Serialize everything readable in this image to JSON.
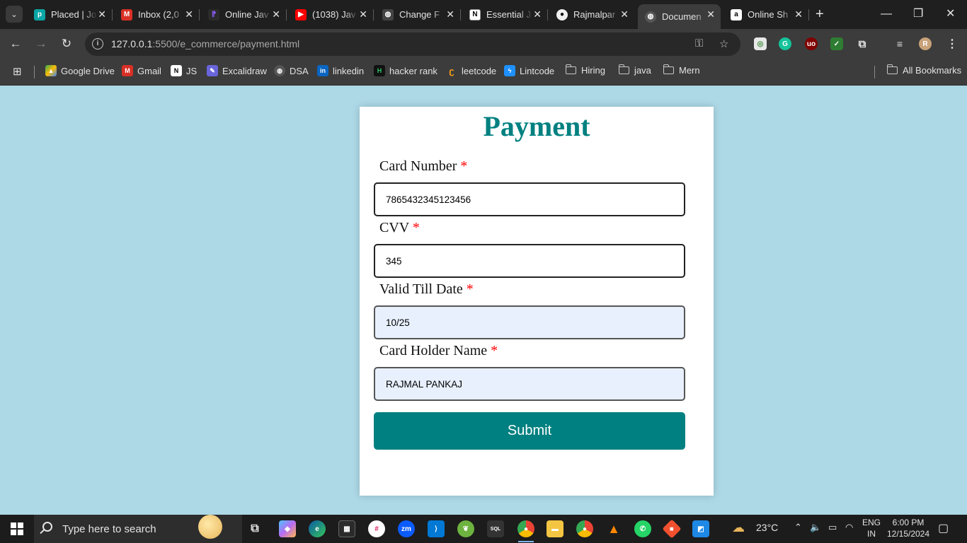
{
  "browser": {
    "tabs": [
      {
        "title": "Placed | Jo",
        "icon": "placed-icon"
      },
      {
        "title": "Inbox (2,0",
        "icon": "gmail-icon"
      },
      {
        "title": "Online Jav",
        "icon": "online-java-icon"
      },
      {
        "title": "(1038) Jav",
        "icon": "youtube-icon"
      },
      {
        "title": "Change F",
        "icon": "globe-icon"
      },
      {
        "title": "Essential J",
        "icon": "notion-icon"
      },
      {
        "title": "Rajmalpar",
        "icon": "github-icon"
      },
      {
        "title": "Documen",
        "icon": "globe-icon",
        "active": true
      },
      {
        "title": "Online Sh",
        "icon": "amazon-icon"
      }
    ],
    "url_host": "127.0.0.1",
    "url_path": ":5500/e_commerce/payment.html",
    "bookmarks": [
      {
        "label": "Google Drive",
        "icon": "google-drive-icon"
      },
      {
        "label": "Gmail",
        "icon": "gmail-icon"
      },
      {
        "label": "JS",
        "icon": "notion-icon"
      },
      {
        "label": "Excalidraw",
        "icon": "excalidraw-icon"
      },
      {
        "label": "DSA",
        "icon": "globe-icon"
      },
      {
        "label": "linkedin",
        "icon": "linkedin-icon"
      },
      {
        "label": "hacker rank",
        "icon": "hackerrank-icon"
      },
      {
        "label": "leetcode",
        "icon": "leetcode-icon"
      },
      {
        "label": "Lintcode",
        "icon": "lintcode-icon"
      },
      {
        "label": "Hiring",
        "icon": "folder-icon"
      },
      {
        "label": "java",
        "icon": "folder-icon"
      },
      {
        "label": "Mern",
        "icon": "folder-icon"
      }
    ],
    "all_bookmarks": "All Bookmarks"
  },
  "page": {
    "title": "Payment",
    "required_mark": "*",
    "fields": {
      "card_number": {
        "label": "Card Number",
        "value": "7865432345123456"
      },
      "cvv": {
        "label": "CVV",
        "value": "345"
      },
      "valid_till": {
        "label": "Valid Till Date",
        "value": "10/25"
      },
      "holder": {
        "label": "Card Holder Name",
        "value": "RAJMAL PANKAJ"
      }
    },
    "submit_label": "Submit"
  },
  "taskbar": {
    "search_placeholder": "Type here to search",
    "weather": "23°C",
    "lang_top": "ENG",
    "lang_bottom": "IN",
    "time": "6:00 PM",
    "date": "12/15/2024"
  },
  "colors": {
    "page_background": "#add8e6",
    "accent": "#008080",
    "required": "#ff0000"
  }
}
